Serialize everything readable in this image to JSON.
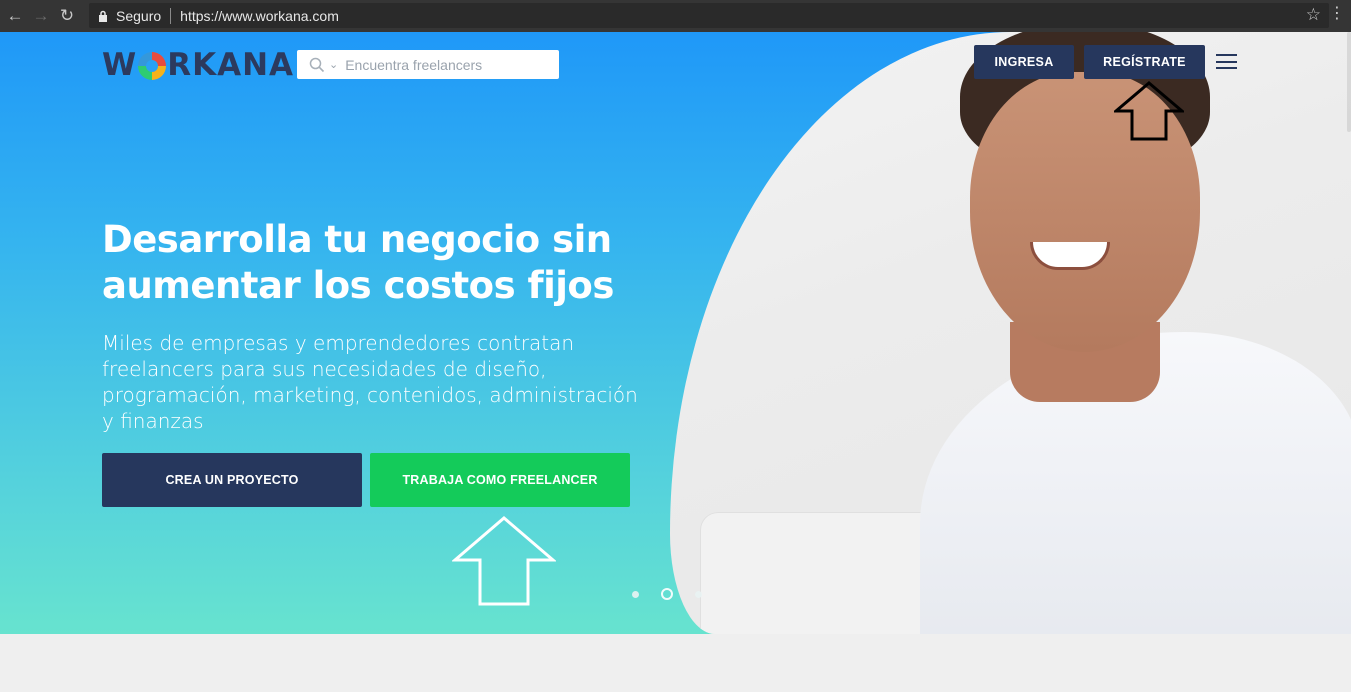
{
  "browser": {
    "secure_label": "Seguro",
    "url": "https://www.workana.com"
  },
  "header": {
    "logo_text_pre": "W",
    "logo_text_post": "RKANA",
    "search_placeholder": "Encuentra freelancers",
    "login_label": "INGRESA",
    "register_label": "REGÍSTRATE"
  },
  "hero": {
    "headline_line1": "Desarrolla tu negocio sin",
    "headline_line2": "aumentar los costos fijos",
    "subtext": "Miles de empresas y emprendedores contratan freelancers para sus necesidades de diseño, programación, marketing, contenidos, administración y finanzas",
    "cta_project": "CREA UN PROYECTO",
    "cta_freelancer": "TRABAJA COMO FREELANCER",
    "carousel_active_index": 2,
    "carousel_count": 3
  },
  "colors": {
    "navy": "#26375d",
    "green": "#14cb5a",
    "hero_top": "#1f98f8",
    "hero_bottom": "#67e3cf"
  }
}
